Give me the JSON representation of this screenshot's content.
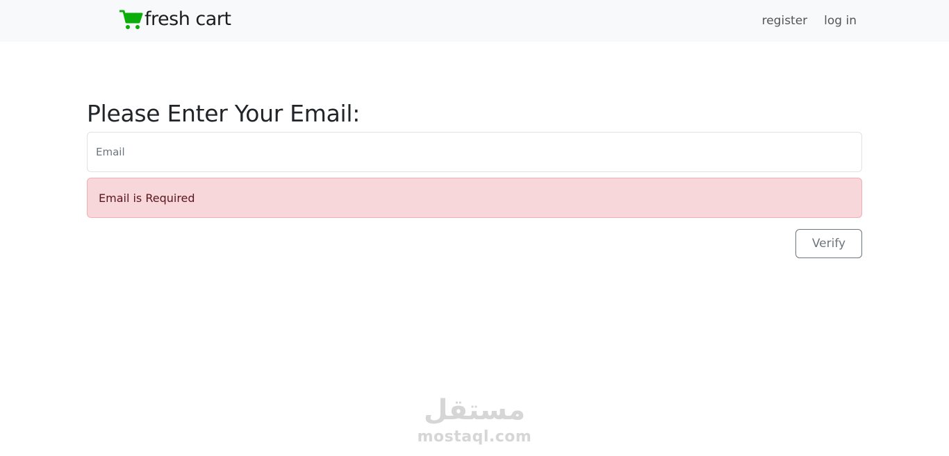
{
  "navbar": {
    "brand": {
      "icon": "cart-icon",
      "icon_color": "#0aad0a",
      "text": "fresh cart"
    },
    "links": [
      {
        "label": "register"
      },
      {
        "label": "log in"
      }
    ]
  },
  "main": {
    "heading": "Please Enter Your Email:",
    "email_field": {
      "value": "",
      "placeholder": "Email"
    },
    "alert": {
      "text": "Email is Required",
      "background": "#f8d7da"
    },
    "verify_button": {
      "label": "Verify"
    }
  },
  "watermark": {
    "arabic": "مستقل",
    "latin": "mostaql.com"
  }
}
